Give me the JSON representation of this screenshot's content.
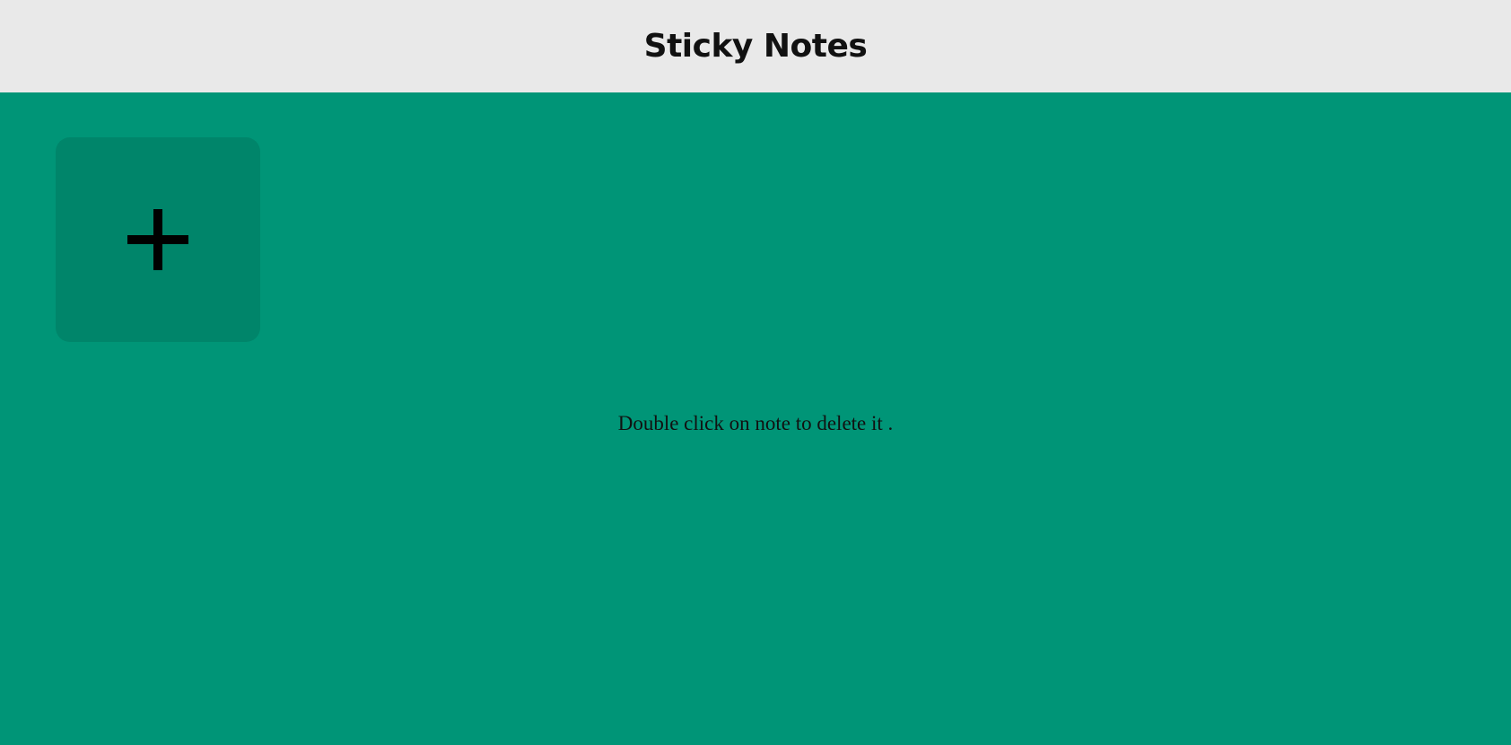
{
  "header": {
    "title": "Sticky Notes"
  },
  "main": {
    "add_note_button": {
      "icon": "plus-icon"
    },
    "hint_text": "Double click on note to delete it ."
  },
  "colors": {
    "background": "#009577",
    "header_background": "#e9e9e9",
    "add_tile": "#00856a"
  }
}
